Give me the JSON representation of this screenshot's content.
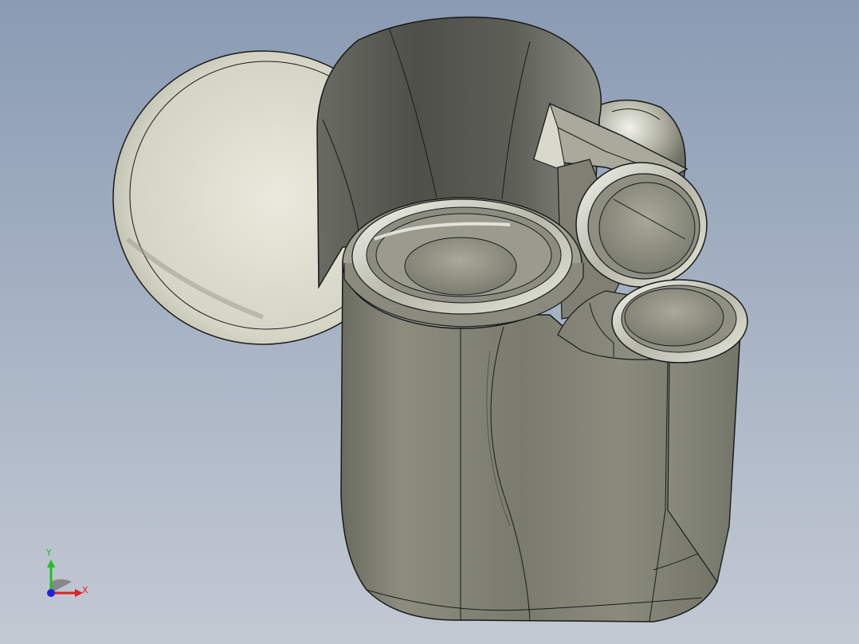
{
  "viewport": {
    "background_top": "#8a9bb3",
    "background_bottom": "#c3c9d3"
  },
  "model": {
    "body_color": "#7c7d70",
    "disc_color": "#dcdcd0",
    "edge_color": "#1a1a1a"
  },
  "triad": {
    "x_label": "X",
    "y_label": "Y",
    "x_color": "#e02020",
    "y_color": "#20c020",
    "z_color": "#2020e0"
  }
}
